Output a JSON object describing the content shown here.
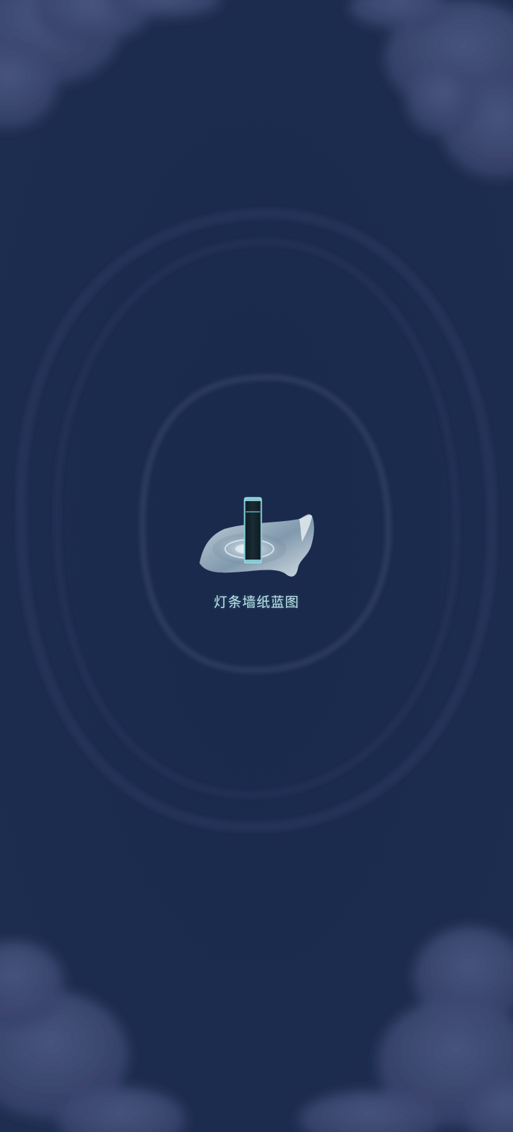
{
  "app": {
    "label": "灯条墙纸蓝图",
    "icon": "lightbar-blueprint-icon"
  },
  "colors": {
    "background": "#1b2a4b",
    "cloud": "#3a4670",
    "ring": "#2b3a60",
    "label": "#bfe6ea",
    "glow_edge": "#7fd0dc"
  }
}
